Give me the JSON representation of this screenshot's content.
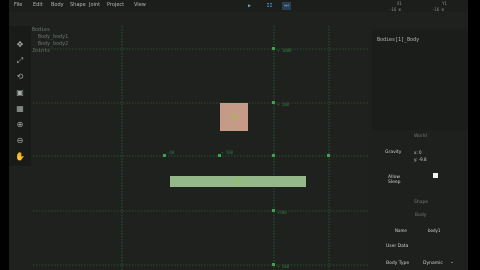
{
  "menu": [
    "File",
    "Edit",
    "Body",
    "Shape",
    "Joint",
    "Project",
    "View"
  ],
  "tools": {
    "t1": "▶",
    "t2": "II",
    "t3": "⏭"
  },
  "coords": {
    "x_label": "X1",
    "x_value": "-16 m",
    "y_label": "Y1",
    "y_value": "-16 m"
  },
  "scene_tree": [
    "Bodies",
    "  Body_body1",
    "  Body_body2",
    "Joints"
  ],
  "toolbar_icons": [
    "move",
    "scale",
    "rotate",
    "select",
    "grid",
    "zoom-in",
    "zoom-out",
    "pan"
  ],
  "canvas_labels": {
    "top": "+ 1000",
    "mid1": "+ 200",
    "mid2": "+ 500",
    "left": "-60",
    "bottom1": "+500",
    "bottom2": "+ 500"
  },
  "properties": {
    "name_input": "Bodies[1]_Body",
    "world_header": "World",
    "gravity_label": "Gravity",
    "gravity_x": "x: 0",
    "gravity_y": "y: -9.8",
    "allow_sleep_label": "Allow Sleep",
    "shape_header": "Shape",
    "body_header": "Body",
    "name_label": "Name",
    "name_value": "body1",
    "user_data_label": "User Data",
    "body_type_label": "Body Type",
    "body_type_value": "Dynamic"
  },
  "colors": {
    "body_box": "#c59a87",
    "ground": "#95b88a",
    "grid": "#2f7a3a",
    "app_bg": "#1f211f"
  }
}
